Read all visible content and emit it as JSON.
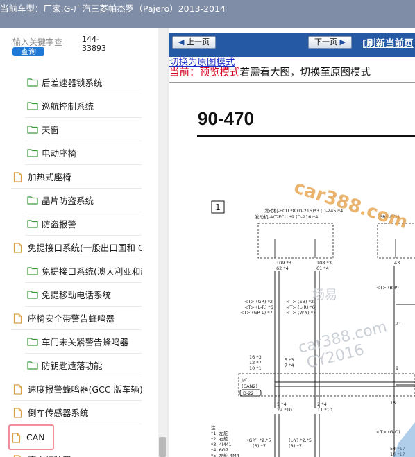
{
  "header": {
    "current_model": "当前车型：厂家:G-广汽三菱帕杰罗（Pajero）2013-2014"
  },
  "sidebar": {
    "search_placeholder": "输入关键字查",
    "search_code": "144-33893",
    "query_button": "查询",
    "items": [
      {
        "label": "后差速器锁系统",
        "level": 2,
        "icon": "folder-icon"
      },
      {
        "label": "巡航控制系统",
        "level": 2,
        "icon": "folder-icon"
      },
      {
        "label": "天窗",
        "level": 2,
        "icon": "folder-icon"
      },
      {
        "label": "电动座椅",
        "level": 2,
        "icon": "folder-icon"
      },
      {
        "label": "加热式座椅",
        "level": 1,
        "icon": "document-icon"
      },
      {
        "label": "晶片防盗系统",
        "level": 2,
        "icon": "folder-icon"
      },
      {
        "label": "防盗报警",
        "level": 2,
        "icon": "folder-icon"
      },
      {
        "label": "免提接口系统(一般出口国和 GCC",
        "level": 1,
        "icon": "document-icon"
      },
      {
        "label": "免提接口系统(澳大利亚和新西",
        "level": 2,
        "icon": "folder-icon"
      },
      {
        "label": "免提移动电话系统",
        "level": 2,
        "icon": "folder-icon"
      },
      {
        "label": "座椅安全带警告蜂鸣器",
        "level": 1,
        "icon": "document-icon"
      },
      {
        "label": "车门未关紧警告蜂鸣器",
        "level": 2,
        "icon": "folder-icon"
      },
      {
        "label": "防钥匙遗落功能",
        "level": 2,
        "icon": "folder-icon"
      },
      {
        "label": "速度报警蜂鸣器(GCC 版车辆)",
        "level": 1,
        "icon": "document-icon"
      },
      {
        "label": "倒车传感器系统",
        "level": 1,
        "icon": "document-icon"
      },
      {
        "label": "CAN",
        "level": 1,
        "icon": "document-icon",
        "selected": true
      },
      {
        "label": "室内灯装置",
        "level": 1,
        "icon": "document-icon"
      }
    ]
  },
  "toolbar": {
    "prev_button": "上一页",
    "next_button": "下一页",
    "refresh_link": "[刷新当前页"
  },
  "content": {
    "switch_link": "切换为原图模式",
    "mode_prefix": "当前：预览模式",
    "mode_rest": "若需看大图，",
    "mode_link": "切换至原图模式"
  },
  "diagram": {
    "page_number": "90-470",
    "section_box": "1",
    "ecu_label_1": "发动机-ECU *8 (D-215)*3 (D-245)*4",
    "ecu_label_2": "发动机-A/T-ECU *9 (D-216)*4",
    "sbs_label": "SBS-ECU",
    "pin_109": "109 *3",
    "pin_62": "62 *4",
    "pin_108": "108 *3",
    "pin_61": "61 *4",
    "pin_43": "43",
    "wire_gr": "<T> (GR) *2",
    "wire_l_r": "<T> (L-R) *6",
    "wire_gr_l": "<T> (GR-L) *7",
    "wire_sb": "<T> (SB) *2",
    "wire_l_r2": "<T> (L-R) *6",
    "wire_w_y": "<T> (W-Y) *7",
    "wire_b_p": "<T> (B-P)",
    "jc_label": "J/C",
    "can2_label": "(CAN2)",
    "d22_label": "D-22",
    "pin_16": "16 *3",
    "pin_12": "12 *7",
    "pin_10": "10 *1",
    "pin_5": "5 *3",
    "pin_7": "7 *4",
    "pin_9": "9",
    "pin_21": "21",
    "pin_15": "15",
    "pin_5b": "5 *4",
    "pin_22": "22 *10",
    "pin_2": "2 *4",
    "pin_11": "11 *10",
    "wire_g_y": "(G-Y) *2,*5",
    "wire_b": "(B) *7",
    "wire_l_y": "(L-Y) *2,*5",
    "wire_r": "(R) *7",
    "wire_g_o": "<T> (G-O)",
    "pin_54": "54 *17",
    "pin_16b": "16 *17",
    "notes": [
      "注",
      "*1: 左舵",
      "*2: 右舵",
      "*3: 4M41",
      "*4: 6G7",
      "*5: 左舵-4M4"
    ],
    "watermark_1": "car388.com",
    "watermark_2": "场易",
    "watermark_3": "car388.com",
    "watermark_4": "CY2016"
  },
  "colors": {
    "topbar": "#7f8da6",
    "nav_bar": "#2559a4",
    "query_button": "#1e79d6",
    "mode_red": "#d6001c",
    "link_blue": "#1b2fc4",
    "watermark": "#e6a24a",
    "selected_border": "#f08f9b"
  }
}
